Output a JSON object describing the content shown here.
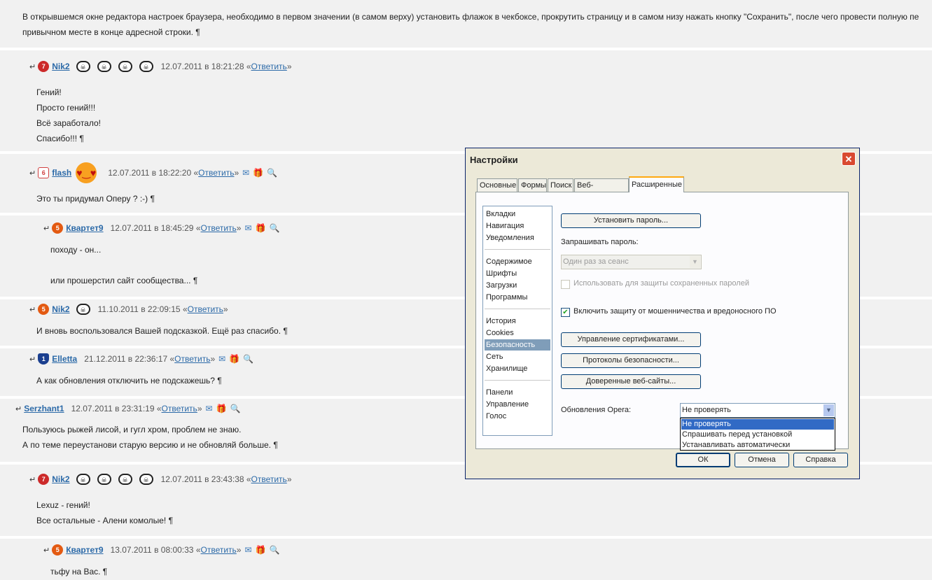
{
  "intro": {
    "line1": "В открывшемся окне редактора настроек браузера, необходимо в первом значении (в самом верху) установить флажок в чекбоксе, прокрутить страницу и в самом низу нажать кнопку \"Сохранить\", после чего провести полную пе",
    "line2": "привычном месте в конце адресной строки. ¶"
  },
  "common": {
    "reply_label": "Ответить",
    "pilcrow": "¶",
    "arrow": "↵",
    "in_word": "в"
  },
  "comments": [
    {
      "user": "Nik2",
      "rank": "7",
      "datetime": "12.07.2011 в 18:21:28",
      "lines": [
        "Гений!",
        "Просто гений!!!",
        "Всё заработало!",
        "Спасибо!!! ¶"
      ]
    },
    {
      "user": "flash",
      "rank": "6",
      "datetime": "12.07.2011 в 18:22:20",
      "lines": [
        "Это ты придумал Оперу ? :-) ¶"
      ]
    },
    {
      "user": "Квартет9",
      "rank": "5",
      "datetime": "12.07.2011 в 18:45:29",
      "lines": [
        "походу - он...",
        "или прошерстил сайт сообщества... ¶"
      ]
    },
    {
      "user": "Nik2",
      "rank": "5",
      "datetime": "11.10.2011 в 22:09:15",
      "lines": [
        "И вновь воспользовался Вашей подсказкой. Ещё раз спасибо. ¶"
      ]
    },
    {
      "user": "Elletta",
      "rank": "1",
      "datetime": "21.12.2011 в 22:36:17",
      "lines": [
        "А как обновления отключить не подскажешь? ¶"
      ]
    },
    {
      "user": "Serzhant1",
      "datetime": "12.07.2011 в 23:31:19",
      "lines": [
        "Пользуюсь рыжей лисой, и гугл хром, проблем не знаю.",
        "А по теме переустанови старую версию и не обновляй больше. ¶"
      ]
    },
    {
      "user": "Nik2",
      "rank": "7",
      "datetime": "12.07.2011 в 23:43:38",
      "lines": [
        "Lexuz - гений!",
        "Все остальные - Алени комолые! ¶"
      ]
    },
    {
      "user": "Квартет9",
      "rank": "5",
      "datetime": "13.07.2011 в 08:00:33",
      "lines": [
        "тьфу на Вас. ¶"
      ]
    }
  ],
  "dialog": {
    "title": "Настройки",
    "close": "✕",
    "tabs": [
      "Основные",
      "Формы",
      "Поиск",
      "Веб-страницы",
      "Расширенные"
    ],
    "sidebar": [
      "Вкладки",
      "Навигация",
      "Уведомления",
      "Содержимое",
      "Шрифты",
      "Загрузки",
      "Программы",
      "История",
      "Cookies",
      "Безопасность",
      "Сеть",
      "Хранилище",
      "Панели",
      "Управление",
      "Голос"
    ],
    "set_password_button": "Установить пароль...",
    "ask_password_label": "Запрашивать пароль:",
    "ask_password_value": "Один раз за сеанс",
    "use_for_saved_label": "Использовать для защиты сохраненных паролей",
    "fraud_protection_label": "Включить защиту от мошенничества и вредоносного ПО",
    "manage_certs_button": "Управление сертификатами...",
    "security_protocols_button": "Протоколы безопасности...",
    "trusted_sites_button": "Доверенные веб-сайты...",
    "updates_label": "Обновления Opera:",
    "updates_value": "Не проверять",
    "updates_options": [
      "Не проверять",
      "Спрашивать перед установкой",
      "Устанавливать автоматически"
    ],
    "ok": "ОК",
    "cancel": "Отмена",
    "help": "Справка"
  }
}
